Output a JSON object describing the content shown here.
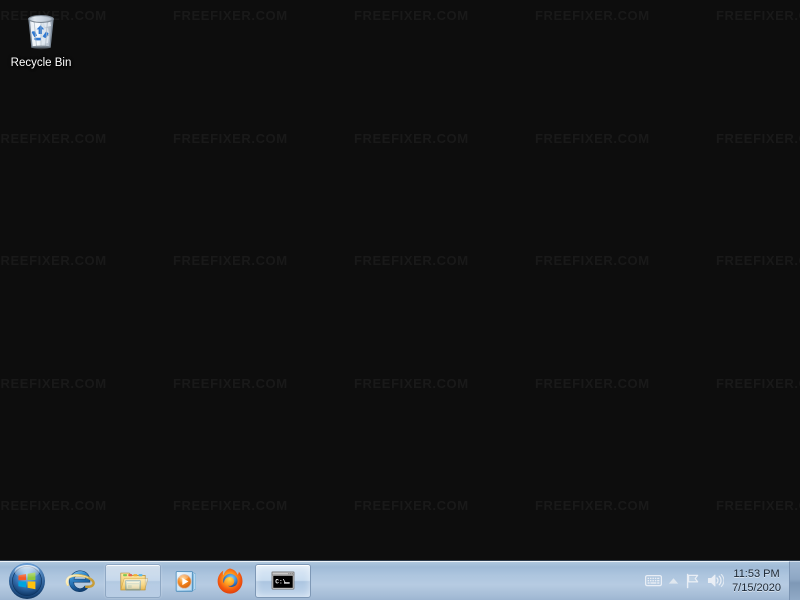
{
  "desktop": {
    "background_color": "#0d0d0d",
    "watermark_text": "FREEFIXER.COM",
    "watermark_color": "#1b1b1b",
    "icons": [
      {
        "name": "recycle-bin",
        "label": "Recycle Bin",
        "icon": "recycle-bin-icon"
      }
    ]
  },
  "taskbar": {
    "background_color": "#aac4dc",
    "start_button": {
      "label": "Start",
      "icon": "windows-start-orb-icon"
    },
    "items": [
      {
        "name": "internet-explorer",
        "label": "Internet Explorer",
        "icon": "internet-explorer-icon",
        "state": "pinned"
      },
      {
        "name": "windows-explorer",
        "label": "Windows Explorer",
        "icon": "folder-explorer-icon",
        "state": "running"
      },
      {
        "name": "windows-media-player",
        "label": "Windows Media Player",
        "icon": "media-player-icon",
        "state": "pinned"
      },
      {
        "name": "mozilla-firefox",
        "label": "Mozilla Firefox",
        "icon": "firefox-icon",
        "state": "pinned"
      },
      {
        "name": "command-prompt",
        "label": "C:\\_",
        "icon": "command-prompt-icon",
        "state": "active"
      }
    ],
    "tray": {
      "icons": [
        {
          "name": "input-indicator",
          "label": "Input indicator",
          "icon": "keyboard-icon"
        },
        {
          "name": "show-hidden-icons",
          "label": "Show hidden icons",
          "icon": "chevron-up-icon"
        },
        {
          "name": "action-center",
          "label": "Action Center",
          "icon": "flag-icon"
        },
        {
          "name": "volume",
          "label": "Volume",
          "icon": "speaker-icon"
        }
      ],
      "clock": {
        "time": "11:53 PM",
        "date": "7/15/2020"
      },
      "show_desktop": {
        "label": "Show desktop"
      }
    }
  }
}
